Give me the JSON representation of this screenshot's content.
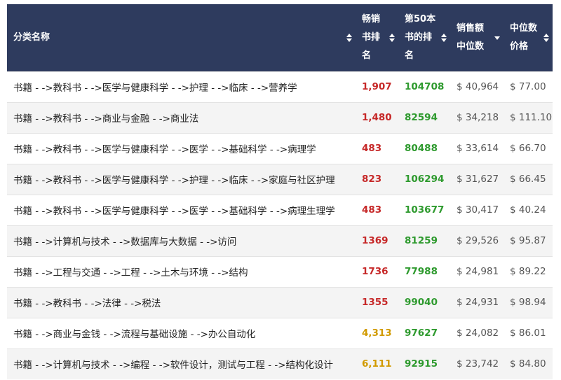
{
  "colors": {
    "header_bg": "#2e3b5e",
    "rank_red": "#c62828",
    "rank_amber": "#d19a00",
    "rank50_green": "#2e9a2e"
  },
  "headers": [
    {
      "label": "分类名称",
      "sort": "both"
    },
    {
      "label": "畅销书排名",
      "sort": "both"
    },
    {
      "label": "第50本书的排名",
      "sort": "both"
    },
    {
      "label": "销售额中位数",
      "sort": "down"
    },
    {
      "label": "中位数价格",
      "sort": "both"
    }
  ],
  "rows": [
    {
      "category": "书籍 - ->教科书 - ->医学与健康科学 - ->护理 - ->临床 - ->营养学",
      "bestseller_rank": "1,907",
      "rank_color": "red",
      "rank_50th": "104708",
      "median_sales": "$ 40,964",
      "median_price": "$ 77.00"
    },
    {
      "category": "书籍 - ->教科书 - ->商业与金融 - ->商业法",
      "bestseller_rank": "1,480",
      "rank_color": "red",
      "rank_50th": "82594",
      "median_sales": "$ 34,218",
      "median_price": "$ 111.10"
    },
    {
      "category": "书籍 - ->教科书 - ->医学与健康科学 - ->医学 - ->基础科学 - ->病理学",
      "bestseller_rank": "483",
      "rank_color": "red",
      "rank_50th": "80488",
      "median_sales": "$ 33,614",
      "median_price": "$ 66.70"
    },
    {
      "category": "书籍 - ->教科书 - ->医学与健康科学 - ->护理 - ->临床 - ->家庭与社区护理",
      "bestseller_rank": "823",
      "rank_color": "red",
      "rank_50th": "106294",
      "median_sales": "$ 31,627",
      "median_price": "$ 66.45"
    },
    {
      "category": "书籍 - ->教科书 - ->医学与健康科学 - ->医学 - ->基础科学 - ->病理生理学",
      "bestseller_rank": "483",
      "rank_color": "red",
      "rank_50th": "103677",
      "median_sales": "$ 30,417",
      "median_price": "$ 40.24"
    },
    {
      "category": "书籍 - ->计算机与技术 - ->数据库与大数据 - ->访问",
      "bestseller_rank": "1369",
      "rank_color": "red",
      "rank_50th": "81259",
      "median_sales": "$ 29,526",
      "median_price": "$ 95.87"
    },
    {
      "category": "书籍 - ->工程与交通 - ->工程 - ->土木与环境 - ->结构",
      "bestseller_rank": "1736",
      "rank_color": "red",
      "rank_50th": "77988",
      "median_sales": "$ 24,981",
      "median_price": "$ 89.22"
    },
    {
      "category": "书籍 - ->教科书 - ->法律 - ->税法",
      "bestseller_rank": "1355",
      "rank_color": "red",
      "rank_50th": "99040",
      "median_sales": "$ 24,931",
      "median_price": "$ 98.94"
    },
    {
      "category": "书籍 - ->商业与金钱 - ->流程与基础设施 - ->办公自动化",
      "bestseller_rank": "4,313",
      "rank_color": "amber",
      "rank_50th": "97627",
      "median_sales": "$ 24,082",
      "median_price": "$ 86.01"
    },
    {
      "category": "书籍 - ->计算机与技术 - ->编程 - ->软件设计，测试与工程 - ->结构化设计",
      "bestseller_rank": "6,111",
      "rank_color": "amber",
      "rank_50th": "92915",
      "median_sales": "$ 23,742",
      "median_price": "$ 84.80"
    }
  ]
}
